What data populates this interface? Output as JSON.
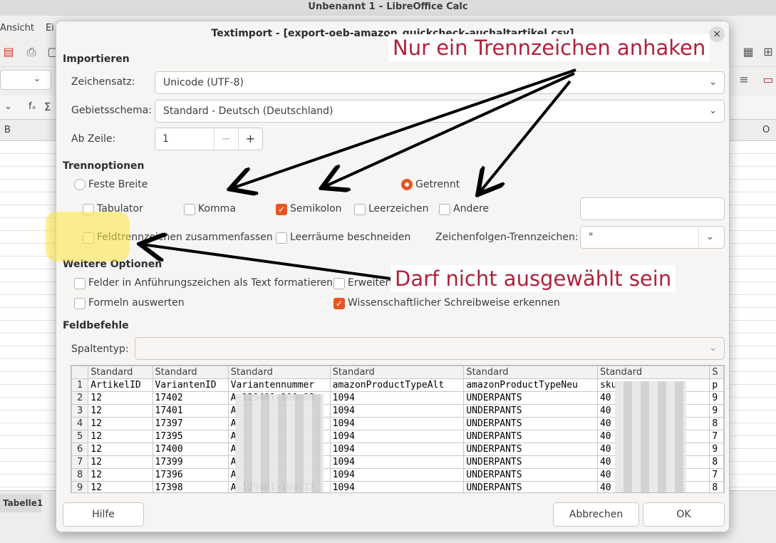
{
  "window": {
    "title": "Unbenannt 1 – LibreOffice Calc",
    "menu_ansicht": "Ansicht",
    "menu_partial": "Ei",
    "col_b": "B",
    "col_o": "O",
    "sheet_tab": "Tabelle1"
  },
  "dialog": {
    "title": "Textimport - [export-oeb-amazon_quickcheck-auchaltartikel.csv]",
    "close": "×",
    "import": {
      "heading": "Importieren",
      "charset_label": "Zeichensatz:",
      "charset_value": "Unicode (UTF-8)",
      "locale_label": "Gebietsschema:",
      "locale_value": "Standard - Deutsch (Deutschland)",
      "from_row_label": "Ab Zeile:",
      "from_row_value": "1"
    },
    "separator_options": {
      "heading": "Trennoptionen",
      "fixed_width": "Feste Breite",
      "separated": "Getrennt",
      "tab": "Tabulator",
      "comma": "Komma",
      "semicolon": "Semikolon",
      "space": "Leerzeichen",
      "other": "Andere",
      "merge_delimiters": "Feldtrennzeichen zusammenfassen",
      "trim_spaces": "Leerräume beschneiden",
      "string_delimiter_label": "Zeichenfolgen-Trennzeichen:",
      "string_delimiter_value": "\""
    },
    "other_options": {
      "heading": "Weitere Optionen",
      "quoted_as_text": "Felder in Anführungszeichen als Text formatieren",
      "detect_special": "Erweitert",
      "evaluate_formulas": "Formeln auswerten",
      "scientific_notation": "Wissenschaftlicher Schreibweise erkennen"
    },
    "fields": {
      "heading": "Feldbefehle",
      "column_type_label": "Spaltentyp:"
    },
    "preview": {
      "column_types": [
        "Standard",
        "Standard",
        "Standard",
        "Standard",
        "Standard",
        "Standard",
        "S"
      ],
      "rows": [
        [
          "1",
          "ArtikelID",
          "VariantenID",
          "Variantennummer",
          "amazonProductTypeAlt",
          "amazonProductTypeNeu",
          "sku",
          "p"
        ],
        [
          "2",
          "12",
          "17402",
          "A-129401-100-08",
          "1094",
          "UNDERPANTS",
          "40",
          "9"
        ],
        [
          "3",
          "12",
          "17401",
          "A",
          "1094",
          "UNDERPANTS",
          "40",
          "9"
        ],
        [
          "4",
          "12",
          "17397",
          "A",
          "1094",
          "UNDERPANTS",
          "40",
          "8"
        ],
        [
          "5",
          "12",
          "17395",
          "A",
          "1094",
          "UNDERPANTS",
          "40",
          "7"
        ],
        [
          "6",
          "12",
          "17400",
          "A",
          "1094",
          "UNDERPANTS",
          "40",
          "9"
        ],
        [
          "7",
          "12",
          "17399",
          "A",
          "1094",
          "UNDERPANTS",
          "40",
          "8"
        ],
        [
          "8",
          "12",
          "17396",
          "A",
          "1094",
          "UNDERPANTS",
          "40",
          "7"
        ],
        [
          "9",
          "12",
          "17398",
          "A-129401-100-12",
          "1094",
          "UNDERPANTS",
          "40",
          "8"
        ]
      ]
    },
    "buttons": {
      "help": "Hilfe",
      "cancel": "Abbrechen",
      "ok": "OK"
    }
  },
  "annotations": {
    "top": "Nur ein Trennzeichen anhaken",
    "bottom": "Darf nicht ausgewählt sein",
    "color": "#b0213a"
  },
  "state": {
    "fixed_width": false,
    "separated": true,
    "tab": false,
    "comma": false,
    "semicolon": true,
    "space": false,
    "other": false,
    "merge_delimiters": false,
    "trim_spaces": false,
    "quoted_as_text": false,
    "detect_special": false,
    "evaluate_formulas": false,
    "scientific_notation": true
  },
  "colors": {
    "accent": "#e95420"
  },
  "icons": [
    "close-icon",
    "chevron-down-icon",
    "minus-icon",
    "plus-icon",
    "checkmark-icon"
  ]
}
